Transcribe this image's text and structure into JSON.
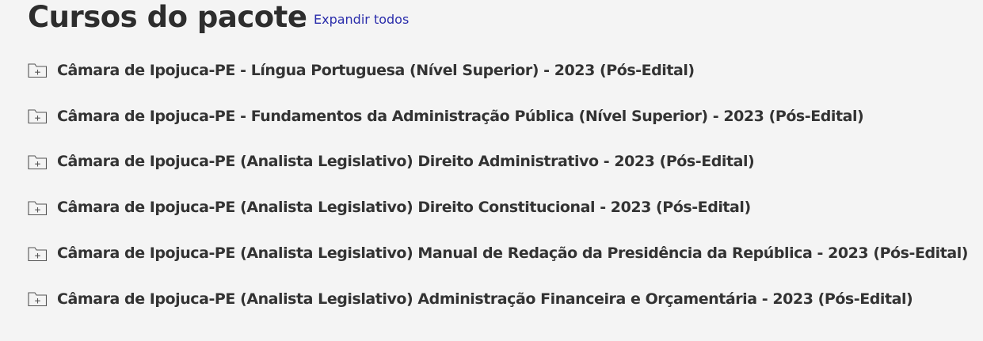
{
  "header": {
    "title": "Cursos do pacote",
    "expand_all_label": "Expandir todos"
  },
  "colors": {
    "background": "#f4f4f4",
    "text": "#333333",
    "link": "#2a2dab"
  },
  "courses": [
    {
      "label": "Câmara de Ipojuca-PE - Língua Portuguesa (Nível Superior) - 2023 (Pós-Edital)",
      "icon": "folder-plus-icon"
    },
    {
      "label": "Câmara de Ipojuca-PE - Fundamentos da Administração Pública (Nível Superior) - 2023 (Pós-Edital)",
      "icon": "folder-plus-icon"
    },
    {
      "label": "Câmara de Ipojuca-PE (Analista Legislativo) Direito Administrativo - 2023 (Pós-Edital)",
      "icon": "folder-plus-icon"
    },
    {
      "label": "Câmara de Ipojuca-PE (Analista Legislativo) Direito Constitucional - 2023 (Pós-Edital)",
      "icon": "folder-plus-icon"
    },
    {
      "label": "Câmara de Ipojuca-PE (Analista Legislativo) Manual de Redação da Presidência da República - 2023 (Pós-Edital)",
      "icon": "folder-plus-icon"
    },
    {
      "label": "Câmara de Ipojuca-PE (Analista Legislativo) Administração Financeira e Orçamentária - 2023 (Pós-Edital)",
      "icon": "folder-plus-icon"
    }
  ]
}
